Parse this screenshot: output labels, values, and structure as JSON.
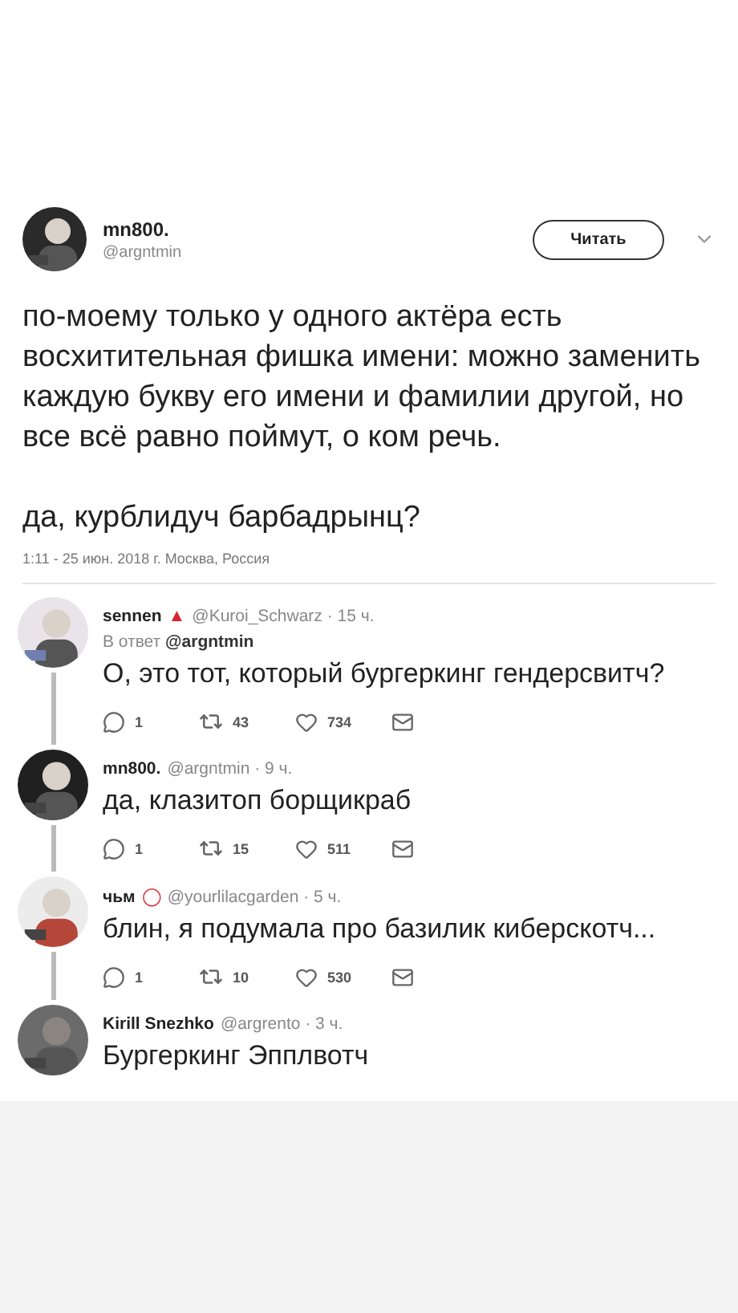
{
  "tweet": {
    "name": "mn800.",
    "handle": "@argntmin",
    "follow_button": "Читать",
    "paragraphs": [
      "по-моему только у одного актёра есть восхитительная фишка имени: можно заменить каждую букву его имени и фамилии другой, но все всё равно поймут, о ком речь.",
      "да, курблидуч барбадрынц?"
    ],
    "meta": "1:11 - 25 июн. 2018 г. Москва, Россия"
  },
  "replies": [
    {
      "name": "sennen",
      "badge": "▲",
      "handle": "@Kuroi_Schwarz · 15 ч.",
      "reply_to_prefix": "В ответ",
      "reply_to": "@argntmin",
      "text": "О, это тот, который бургеркинг гендерсвитч?",
      "stats": {
        "replies": "1",
        "retweets": "43",
        "likes": "734"
      }
    },
    {
      "name": "mn800.",
      "handle": "@argntmin · 9 ч.",
      "text": "да, клазитоп борщикраб",
      "stats": {
        "replies": "1",
        "retweets": "15",
        "likes": "511"
      }
    },
    {
      "name": "чьм",
      "badge": "◯",
      "handle": "@yourlilacgarden · 5 ч.",
      "text": "блин, я подумала про базилик киберскотч...",
      "stats": {
        "replies": "1",
        "retweets": "10",
        "likes": "530"
      }
    },
    {
      "name": "Kirill Snezhko",
      "handle": "@argrento · 3 ч.",
      "text": "Бургеркинг Эпплвотч"
    }
  ]
}
